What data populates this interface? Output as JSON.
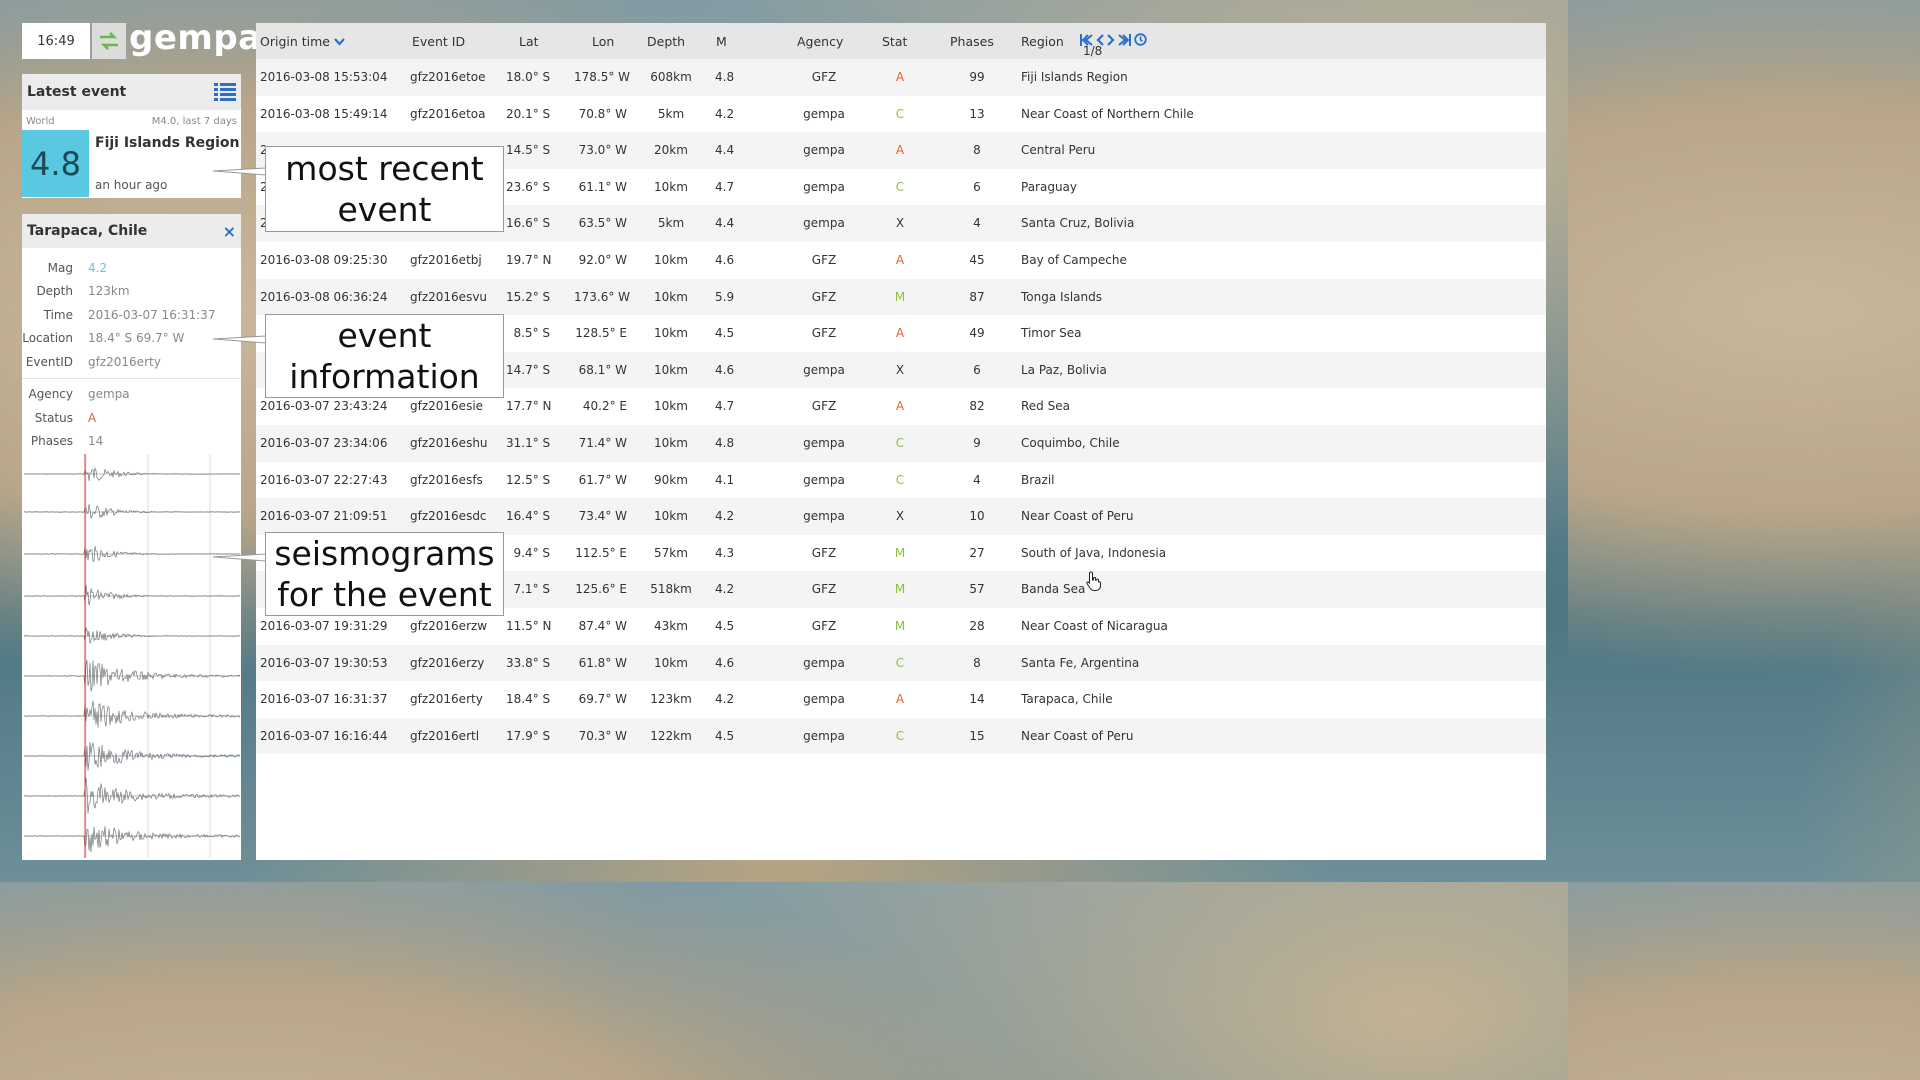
{
  "topbar": {
    "clock": "16:49",
    "logo": "gempa"
  },
  "latest": {
    "title": "Latest event",
    "scope": "World",
    "filter": "M4.0, last 7 days",
    "magnitude": "4.8",
    "region": "Fiji Islands Region",
    "ago": "an hour ago"
  },
  "detail": {
    "title": "Tarapaca, Chile",
    "close": "×",
    "fields": [
      {
        "k": "Mag",
        "v": "4.2"
      },
      {
        "k": "Depth",
        "v": "123km"
      },
      {
        "k": "Time",
        "v": "2016-03-07 16:31:37"
      },
      {
        "k": "Location",
        "v": "18.4° S 69.7° W"
      },
      {
        "k": "EventID",
        "v": "gfz2016erty"
      }
    ],
    "fields2": [
      {
        "k": "Agency",
        "v": "gempa"
      },
      {
        "k": "Status",
        "v": "A"
      },
      {
        "k": "Phases",
        "v": "14"
      }
    ]
  },
  "table": {
    "headers": {
      "time": "Origin time",
      "id": "Event ID",
      "lat": "Lat",
      "lon": "Lon",
      "depth": "Depth",
      "mag": "M",
      "agency": "Agency",
      "stat": "Stat",
      "phases": "Phases",
      "region": "Region"
    },
    "page": "1/8",
    "rows": [
      {
        "time": "2016-03-08 15:53:04",
        "id": "gfz2016etoe",
        "lat": "18.0° S",
        "lon": "178.5° W",
        "depth": "608km",
        "mag": "4.8",
        "agency": "GFZ",
        "stat": "A",
        "phases": "99",
        "region": "Fiji Islands Region"
      },
      {
        "time": "2016-03-08 15:49:14",
        "id": "gfz2016etoa",
        "lat": "20.1° S",
        "lon": "70.8° W",
        "depth": "5km",
        "mag": "4.2",
        "agency": "gempa",
        "stat": "C",
        "phases": "13",
        "region": "Near Coast of Northern Chile"
      },
      {
        "time": "2",
        "id": "",
        "lat": "14.5° S",
        "lon": "73.0° W",
        "depth": "20km",
        "mag": "4.4",
        "agency": "gempa",
        "stat": "A",
        "phases": "8",
        "region": "Central Peru"
      },
      {
        "time": "2",
        "id": "",
        "lat": "23.6° S",
        "lon": "61.1° W",
        "depth": "10km",
        "mag": "4.7",
        "agency": "gempa",
        "stat": "C",
        "phases": "6",
        "region": "Paraguay"
      },
      {
        "time": "2",
        "id": "",
        "lat": "16.6° S",
        "lon": "63.5° W",
        "depth": "5km",
        "mag": "4.4",
        "agency": "gempa",
        "stat": "X",
        "phases": "4",
        "region": "Santa Cruz, Bolivia"
      },
      {
        "time": "2016-03-08 09:25:30",
        "id": "gfz2016etbj",
        "lat": "19.7° N",
        "lon": "92.0° W",
        "depth": "10km",
        "mag": "4.6",
        "agency": "GFZ",
        "stat": "A",
        "phases": "45",
        "region": "Bay of Campeche"
      },
      {
        "time": "2016-03-08 06:36:24",
        "id": "gfz2016esvu",
        "lat": "15.2° S",
        "lon": "173.6° W",
        "depth": "10km",
        "mag": "5.9",
        "agency": "GFZ",
        "stat": "M",
        "phases": "87",
        "region": "Tonga Islands"
      },
      {
        "time": "",
        "id": "",
        "lat": "8.5° S",
        "lon": "128.5° E",
        "depth": "10km",
        "mag": "4.5",
        "agency": "GFZ",
        "stat": "A",
        "phases": "49",
        "region": "Timor Sea"
      },
      {
        "time": "",
        "id": "",
        "lat": "14.7° S",
        "lon": "68.1° W",
        "depth": "10km",
        "mag": "4.6",
        "agency": "gempa",
        "stat": "X",
        "phases": "6",
        "region": "La Paz, Bolivia"
      },
      {
        "time": "2016-03-07 23:43:24",
        "id": "gfz2016esie",
        "lat": "17.7° N",
        "lon": "40.2° E",
        "depth": "10km",
        "mag": "4.7",
        "agency": "GFZ",
        "stat": "A",
        "phases": "82",
        "region": "Red Sea"
      },
      {
        "time": "2016-03-07 23:34:06",
        "id": "gfz2016eshu",
        "lat": "31.1° S",
        "lon": "71.4° W",
        "depth": "10km",
        "mag": "4.8",
        "agency": "gempa",
        "stat": "C",
        "phases": "9",
        "region": "Coquimbo, Chile"
      },
      {
        "time": "2016-03-07 22:27:43",
        "id": "gfz2016esfs",
        "lat": "12.5° S",
        "lon": "61.7° W",
        "depth": "90km",
        "mag": "4.1",
        "agency": "gempa",
        "stat": "C",
        "phases": "4",
        "region": "Brazil"
      },
      {
        "time": "2016-03-07 21:09:51",
        "id": "gfz2016esdc",
        "lat": "16.4° S",
        "lon": "73.4° W",
        "depth": "10km",
        "mag": "4.2",
        "agency": "gempa",
        "stat": "X",
        "phases": "10",
        "region": "Near Coast of Peru"
      },
      {
        "time": "",
        "id": "",
        "lat": "9.4° S",
        "lon": "112.5° E",
        "depth": "57km",
        "mag": "4.3",
        "agency": "GFZ",
        "stat": "M",
        "phases": "27",
        "region": "South of Java, Indonesia"
      },
      {
        "time": "",
        "id": "",
        "lat": "7.1° S",
        "lon": "125.6° E",
        "depth": "518km",
        "mag": "4.2",
        "agency": "GFZ",
        "stat": "M",
        "phases": "57",
        "region": "Banda Sea"
      },
      {
        "time": "2016-03-07 19:31:29",
        "id": "gfz2016erzw",
        "lat": "11.5° N",
        "lon": "87.4° W",
        "depth": "43km",
        "mag": "4.5",
        "agency": "GFZ",
        "stat": "M",
        "phases": "28",
        "region": "Near Coast of Nicaragua"
      },
      {
        "time": "2016-03-07 19:30:53",
        "id": "gfz2016erzy",
        "lat": "33.8° S",
        "lon": "61.8° W",
        "depth": "10km",
        "mag": "4.6",
        "agency": "gempa",
        "stat": "C",
        "phases": "8",
        "region": "Santa Fe, Argentina"
      },
      {
        "time": "2016-03-07 16:31:37",
        "id": "gfz2016erty",
        "lat": "18.4° S",
        "lon": "69.7° W",
        "depth": "123km",
        "mag": "4.2",
        "agency": "gempa",
        "stat": "A",
        "phases": "14",
        "region": "Tarapaca, Chile"
      },
      {
        "time": "2016-03-07 16:16:44",
        "id": "gfz2016ertl",
        "lat": "17.9° S",
        "lon": "70.3° W",
        "depth": "122km",
        "mag": "4.5",
        "agency": "gempa",
        "stat": "C",
        "phases": "15",
        "region": "Near Coast of Peru"
      }
    ]
  },
  "callouts": {
    "recent": "most recent event",
    "info": "event information",
    "seismo": "seismograms for the event"
  },
  "colors": {
    "accent": "#2a6fc9",
    "magbox": "#5ac8e0",
    "statusA": "#e8602c",
    "statusC": "#8fbf3a"
  }
}
